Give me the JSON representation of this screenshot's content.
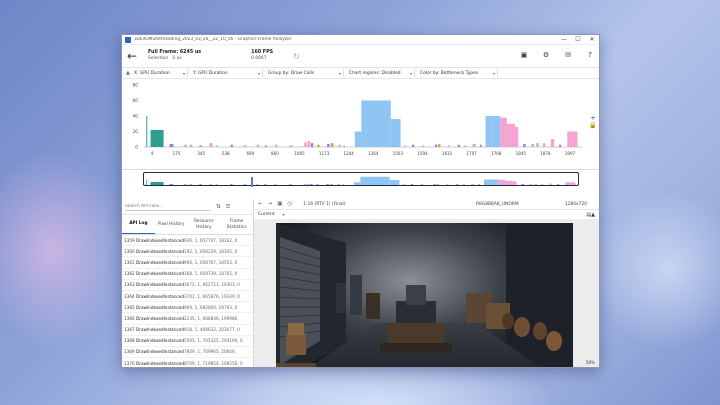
{
  "window": {
    "title": "3DEXOMultithreading_2023_03_26__22_10_56 - Graphics Frame Analyzer",
    "controls": [
      "—",
      "☐",
      "✕"
    ]
  },
  "toolbar": {
    "back_icon": "back-arrow-icon",
    "full_frame_label": "Full Frame: 6245 us",
    "selection_label": "Selection",
    "selection_value": "0 us",
    "fps_label": "160 FPS",
    "fps_value": "0.0067",
    "right_icons": [
      "external-window-icon",
      "gear-icon",
      "mail-icon",
      "help-icon"
    ],
    "help_label": "?"
  },
  "filters": [
    {
      "label": "X: GPU Duration"
    },
    {
      "label": "Y: GPU Duration"
    },
    {
      "label": "Group by: Draw Calls"
    },
    {
      "label": "Chart regions: Disabled"
    },
    {
      "label": "Color by: Bottleneck Types"
    }
  ],
  "chart_data": {
    "type": "bar",
    "yticks": [
      "80",
      "60",
      "40",
      "20",
      "0"
    ],
    "ylim": [
      0,
      80
    ],
    "xticks": [
      "4",
      "175",
      "345",
      "538",
      "699",
      "860",
      "1065",
      "1173",
      "1244",
      "1364",
      "1563",
      "1594",
      "1631",
      "1707",
      "1708",
      "1845",
      "1878",
      "1997"
    ],
    "bars": [
      {
        "x": 0.7,
        "w": 0.1,
        "h": 40,
        "c": "#2e9e8f"
      },
      {
        "x": 2.0,
        "w": 4.0,
        "h": 22,
        "c": "#2e9e8f"
      },
      {
        "x": 7.8,
        "w": 1.2,
        "h": 4,
        "c": "#9f7fd8"
      },
      {
        "x": 12.2,
        "w": 1.0,
        "h": 3,
        "c": "#f0a6c6"
      },
      {
        "x": 14.0,
        "w": 0.8,
        "h": 3,
        "c": "#9bc3e8"
      },
      {
        "x": 17.0,
        "w": 0.7,
        "h": 2,
        "c": "#9f7fd8"
      },
      {
        "x": 20.0,
        "w": 1.0,
        "h": 5,
        "c": "#f0a6c6"
      },
      {
        "x": 22.0,
        "w": 0.6,
        "h": 2,
        "c": "#9bc3e8"
      },
      {
        "x": 26.5,
        "w": 0.7,
        "h": 3,
        "c": "#9f7fd8"
      },
      {
        "x": 30.5,
        "w": 1.0,
        "h": 2,
        "c": "#9bc3e8"
      },
      {
        "x": 34.5,
        "w": 0.8,
        "h": 3,
        "c": "#f0a6c6"
      },
      {
        "x": 37.0,
        "w": 0.6,
        "h": 2,
        "c": "#9f7fd8"
      },
      {
        "x": 40.0,
        "w": 0.8,
        "h": 3,
        "c": "#f0a6c6"
      },
      {
        "x": 44.5,
        "w": 1.0,
        "h": 2,
        "c": "#9bc3e8"
      },
      {
        "x": 49.0,
        "w": 0.8,
        "h": 6,
        "c": "#f0a6c6"
      },
      {
        "x": 50.0,
        "w": 0.8,
        "h": 8,
        "c": "#f0a6c6"
      },
      {
        "x": 51.0,
        "w": 0.8,
        "h": 5,
        "c": "#9f7fd8"
      },
      {
        "x": 53.0,
        "w": 0.7,
        "h": 3,
        "c": "#d9a04a"
      },
      {
        "x": 56.0,
        "w": 0.8,
        "h": 4,
        "c": "#9f7fd8"
      },
      {
        "x": 57.2,
        "w": 0.8,
        "h": 5,
        "c": "#d9a04a"
      },
      {
        "x": 59.5,
        "w": 0.7,
        "h": 3,
        "c": "#9bc3e8"
      },
      {
        "x": 61.0,
        "w": 0.6,
        "h": 2,
        "c": "#9bc3e8"
      },
      {
        "x": 64.5,
        "w": 2.0,
        "h": 20,
        "c": "#8ec5f2"
      },
      {
        "x": 66.5,
        "w": 6.0,
        "h": 60,
        "c": "#8ec5f2"
      },
      {
        "x": 72.5,
        "w": 3.0,
        "h": 60,
        "c": "#8ec5f2"
      },
      {
        "x": 75.5,
        "w": 3.0,
        "h": 36,
        "c": "#8ec5f2"
      },
      {
        "x": 79.5,
        "w": 0.6,
        "h": 2,
        "c": "#9bc3e8"
      },
      {
        "x": 82.0,
        "w": 0.7,
        "h": 3,
        "c": "#9f7fd8"
      },
      {
        "x": 85.0,
        "w": 0.8,
        "h": 2,
        "c": "#f0a6c6"
      },
      {
        "x": 89.0,
        "w": 0.7,
        "h": 3,
        "c": "#9f7fd8"
      },
      {
        "x": 90.0,
        "w": 0.7,
        "h": 4,
        "c": "#d9a04a"
      },
      {
        "x": 93.0,
        "w": 0.6,
        "h": 2,
        "c": "#9bc3e8"
      },
      {
        "x": 96.0,
        "w": 0.6,
        "h": 3,
        "c": "#9f7fd8"
      },
      {
        "x": 98.0,
        "w": 0.6,
        "h": 2,
        "c": "#9bc3e8"
      },
      {
        "x": 100.5,
        "w": 1.0,
        "h": 4,
        "c": "#f0a6c6"
      },
      {
        "x": 102.8,
        "w": 0.5,
        "h": 3,
        "c": "#9f7fd8"
      },
      {
        "x": 104.5,
        "w": 2.0,
        "h": 40,
        "c": "#8ec5f2"
      },
      {
        "x": 106.5,
        "w": 2.5,
        "h": 40,
        "c": "#8ec5f2"
      },
      {
        "x": 109.0,
        "w": 2.0,
        "h": 38,
        "c": "#f5a3d3"
      },
      {
        "x": 111.0,
        "w": 2.5,
        "h": 30,
        "c": "#f5a3d3"
      },
      {
        "x": 113.5,
        "w": 1.0,
        "h": 26,
        "c": "#f5a3d3"
      },
      {
        "x": 116.0,
        "w": 0.8,
        "h": 4,
        "c": "#9f7fd8"
      },
      {
        "x": 118.5,
        "w": 0.8,
        "h": 4,
        "c": "#f0a6c6"
      },
      {
        "x": 120.0,
        "w": 0.8,
        "h": 5,
        "c": "#9bc3e8"
      },
      {
        "x": 122.0,
        "w": 0.8,
        "h": 5,
        "c": "#f0a6c6"
      },
      {
        "x": 124.5,
        "w": 1.0,
        "h": 10,
        "c": "#f0a6c6"
      },
      {
        "x": 127.0,
        "w": 0.6,
        "h": 3,
        "c": "#9f7fd8"
      },
      {
        "x": 129.5,
        "w": 1.5,
        "h": 20,
        "c": "#f5a3d3"
      },
      {
        "x": 131.0,
        "w": 1.6,
        "h": 20,
        "c": "#f5a3d3"
      }
    ],
    "xmax": 134
  },
  "chart_side": [
    "+",
    "🔒"
  ],
  "left_panel": {
    "search_placeholder": "Search API calls...",
    "tabs": [
      "API Log",
      "Pixel History",
      "Resource History",
      "Frame Statistics"
    ],
    "rows": [
      {
        "id": "1359",
        "name": "DrawIndexedInstanced",
        "args": "936, 1, 657747, 18162, 0"
      },
      {
        "id": "1360",
        "name": "DrawIndexedInstanced",
        "args": "192, 1, 658229, 18345, 0"
      },
      {
        "id": "1361",
        "name": "DrawIndexedInstanced",
        "args": "966, 1, 658767, 18553, 0"
      },
      {
        "id": "1362",
        "name": "DrawIndexedInstanced",
        "args": "168, 1, 659739, 18765, 0"
      },
      {
        "id": "1363",
        "name": "DrawIndexedInstanced",
        "args": "3672, 1, 662723, 19303, 0"
      },
      {
        "id": "1364",
        "name": "DrawIndexedInstanced",
        "args": "3702, 1, 665876, 19339, 0"
      },
      {
        "id": "1365",
        "name": "DrawIndexedInstanced",
        "args": "969, 1, 682800, 19793, 0"
      },
      {
        "id": "1366",
        "name": "DrawIndexedInstanced",
        "args": "2235, 1, 688836, 199986,"
      },
      {
        "id": "1367",
        "name": "DrawIndexedInstanced",
        "args": "918, 1, 408632, 203477, 0"
      },
      {
        "id": "1368",
        "name": "DrawIndexedInstanced",
        "args": "5505, 1, 705325, 204169, 0"
      },
      {
        "id": "1369",
        "name": "DrawIndexedInstanced",
        "args": "7809, 1, 709965, 20649,"
      },
      {
        "id": "1370",
        "name": "DrawIndexedInstanced",
        "args": "8709, 1, 719854, 209256, 0"
      },
      {
        "id": "1371",
        "name": "DrawIndexedInstanced",
        "args": "7809, 1, 738263, 212354,"
      },
      {
        "id": "1372",
        "name": "DrawIndexedInstanced",
        "args": "5451, 1, 745664, 25480"
      }
    ]
  },
  "right_panel": {
    "render_target": "1:16 (RTV 1) (Final)",
    "format": "R8G8B8A8_UNORM",
    "resolution": "1280x720",
    "view_select": "Current",
    "zoom": "58%"
  }
}
